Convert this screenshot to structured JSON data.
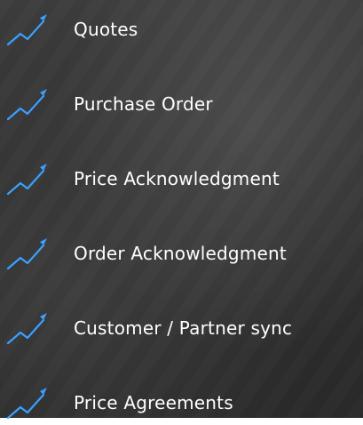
{
  "items": [
    {
      "label": "Quotes",
      "icon": "trend-up-arrow-icon"
    },
    {
      "label": "Purchase Order",
      "icon": "trend-up-arrow-icon"
    },
    {
      "label": "Price Acknowledgment",
      "icon": "trend-up-arrow-icon"
    },
    {
      "label": "Order Acknowledgment",
      "icon": "trend-up-arrow-icon"
    },
    {
      "label": "Customer / Partner sync",
      "icon": "trend-up-arrow-icon"
    },
    {
      "label": "Price Agreements",
      "icon": "trend-up-arrow-icon"
    }
  ],
  "colors": {
    "text": "#ffffff",
    "icon": "#3aa0ff",
    "background": "#333333"
  }
}
